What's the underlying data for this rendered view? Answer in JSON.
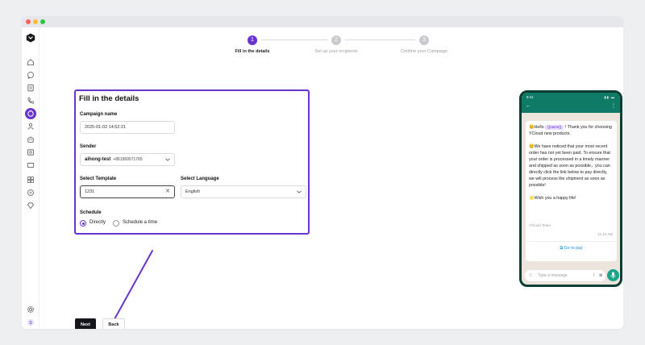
{
  "stepper": {
    "steps": [
      {
        "number": "1",
        "label": "Fill in the details",
        "active": true
      },
      {
        "number": "2",
        "label": "Set up your recipients",
        "active": false
      },
      {
        "number": "3",
        "label": "Confirm your Campaign",
        "active": false
      }
    ]
  },
  "form": {
    "title": "Fill in the details",
    "campaign_name_label": "Campaign name",
    "campaign_name_value": "2025-01-02 14:52:21",
    "sender_label": "Sender",
    "sender_name": "aihong-test",
    "sender_phone": "+861569571765",
    "template_label": "Select Template",
    "template_value": "1231",
    "language_label": "Select Language",
    "language_value": "English",
    "schedule_label": "Schedule",
    "schedule_options": [
      "Directly",
      "Schedule a time"
    ],
    "schedule_selected": "Directly"
  },
  "actions": {
    "next_label": "Next",
    "back_label": "Back"
  },
  "phone": {
    "time": "9:41",
    "message": {
      "line1_prefix": "😊Hello",
      "variable": "{{name}}",
      "line1_suffix": "! Thank you for choosing YCloud new products.",
      "para2": "😊We have noticed that your most recent order has not yet been paid. To ensure that your order is processed in a timely manner and shipped as soon as possible，you can directly click the link below to pay directly, we will process the shipment as soon as possible!",
      "para3": "🌟Wish you a happy life!",
      "signature": "YCloud Team",
      "time": "11:14 AM",
      "button": "Go to pay"
    },
    "input_placeholder": "Type a message"
  },
  "icons": {
    "sidebar": [
      "logo-icon",
      "home-icon",
      "chat-icon",
      "contacts-icon",
      "phone-icon",
      "campaign-icon",
      "users-icon",
      "bot-icon",
      "inbox-icon",
      "mail-icon",
      "apps-icon",
      "settings-circle-icon",
      "diamond-icon",
      "gear-icon",
      "avatar-icon"
    ]
  },
  "colors": {
    "accent": "#6a35cf",
    "phone_header": "#0f7a65",
    "button_dark": "#15171c"
  }
}
